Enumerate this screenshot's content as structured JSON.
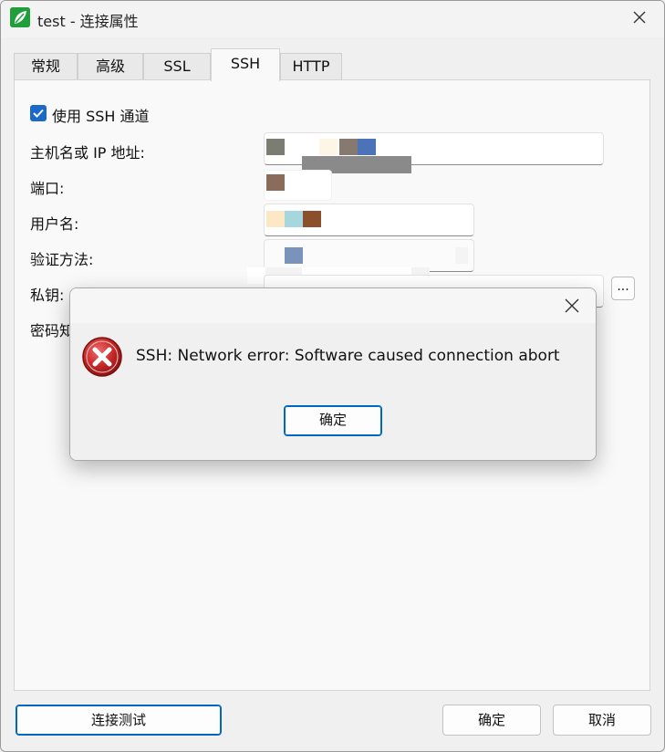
{
  "window": {
    "title": "test - 连接属性",
    "close_icon": "close-icon"
  },
  "tabs": [
    {
      "label": "常规",
      "active": false
    },
    {
      "label": "高级",
      "active": false
    },
    {
      "label": "SSL",
      "active": false
    },
    {
      "label": "SSH",
      "active": true
    },
    {
      "label": "HTTP",
      "active": false
    }
  ],
  "ssh": {
    "use_tunnel_label": "使用 SSH 通道",
    "use_tunnel_checked": true,
    "host_label": "主机名或 IP 地址:",
    "port_label": "端口:",
    "user_label": "用户名:",
    "auth_label": "验证方法:",
    "key_label": "私钥:",
    "passphrase_label_partial": "密码知",
    "browse_label": "..."
  },
  "footer": {
    "test_button": "连接测试",
    "ok_button": "确定",
    "cancel_button": "取消"
  },
  "error_dialog": {
    "message": "SSH: Network error: Software caused connection abort",
    "ok_button": "确定",
    "icon": "error-icon"
  },
  "colors": {
    "accent": "#0067c0",
    "checkbox": "#1b6ac9",
    "error_red": "#c62828",
    "app_icon": "#1f9e3b"
  }
}
